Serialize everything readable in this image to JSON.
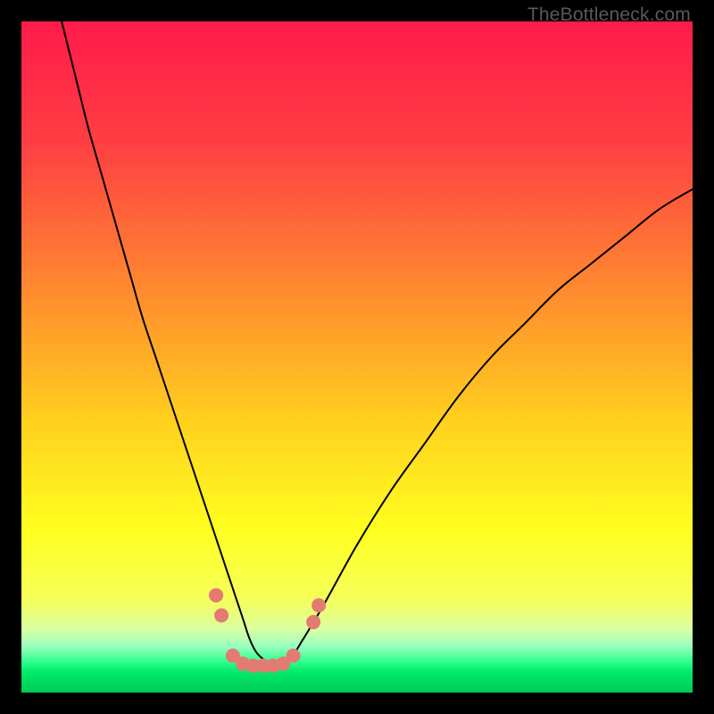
{
  "watermark": "TheBottleneck.com",
  "chart_data": {
    "type": "line",
    "title": "",
    "xlabel": "",
    "ylabel": "",
    "xlim": [
      0,
      100
    ],
    "ylim": [
      0,
      100
    ],
    "grid": false,
    "legend": false,
    "background_gradient_stops": [
      {
        "pos": 0.0,
        "color": "#ff1b4a"
      },
      {
        "pos": 0.18,
        "color": "#ff3e43"
      },
      {
        "pos": 0.4,
        "color": "#ff8a2f"
      },
      {
        "pos": 0.6,
        "color": "#ffd21e"
      },
      {
        "pos": 0.76,
        "color": "#ffff20"
      },
      {
        "pos": 0.86,
        "color": "#f6ff5a"
      },
      {
        "pos": 0.905,
        "color": "#daffa0"
      },
      {
        "pos": 0.93,
        "color": "#9dffc0"
      },
      {
        "pos": 0.955,
        "color": "#2bff8b"
      },
      {
        "pos": 0.97,
        "color": "#00e868"
      },
      {
        "pos": 1.0,
        "color": "#00cc55"
      }
    ],
    "series": [
      {
        "name": "bottleneck-curve",
        "color": "#000000",
        "width": 2.0,
        "x": [
          6,
          8,
          10,
          12,
          14,
          16,
          18,
          20,
          22,
          24,
          26,
          28,
          30,
          32,
          33,
          34,
          35,
          36,
          37,
          38,
          40,
          42,
          45,
          50,
          55,
          60,
          65,
          70,
          75,
          80,
          85,
          90,
          95,
          100
        ],
        "y": [
          100,
          92,
          84,
          77,
          70,
          63,
          56,
          50,
          44,
          38,
          32,
          26,
          20,
          14,
          11,
          8,
          6,
          5,
          4,
          4,
          5,
          8,
          13,
          22,
          30,
          37,
          44,
          50,
          55,
          60,
          64,
          68,
          72,
          75
        ]
      }
    ],
    "markers": {
      "name": "overlay-dots",
      "color": "#e47b73",
      "radius_px": 8,
      "points": [
        {
          "x": 29.0,
          "y": 14.5
        },
        {
          "x": 29.8,
          "y": 11.5
        },
        {
          "x": 31.5,
          "y": 5.5
        },
        {
          "x": 33.0,
          "y": 4.3
        },
        {
          "x": 34.5,
          "y": 4.0
        },
        {
          "x": 36.0,
          "y": 4.0
        },
        {
          "x": 37.5,
          "y": 4.0
        },
        {
          "x": 39.0,
          "y": 4.3
        },
        {
          "x": 40.5,
          "y": 5.5
        },
        {
          "x": 43.5,
          "y": 10.5
        },
        {
          "x": 44.3,
          "y": 13.0
        }
      ]
    }
  }
}
